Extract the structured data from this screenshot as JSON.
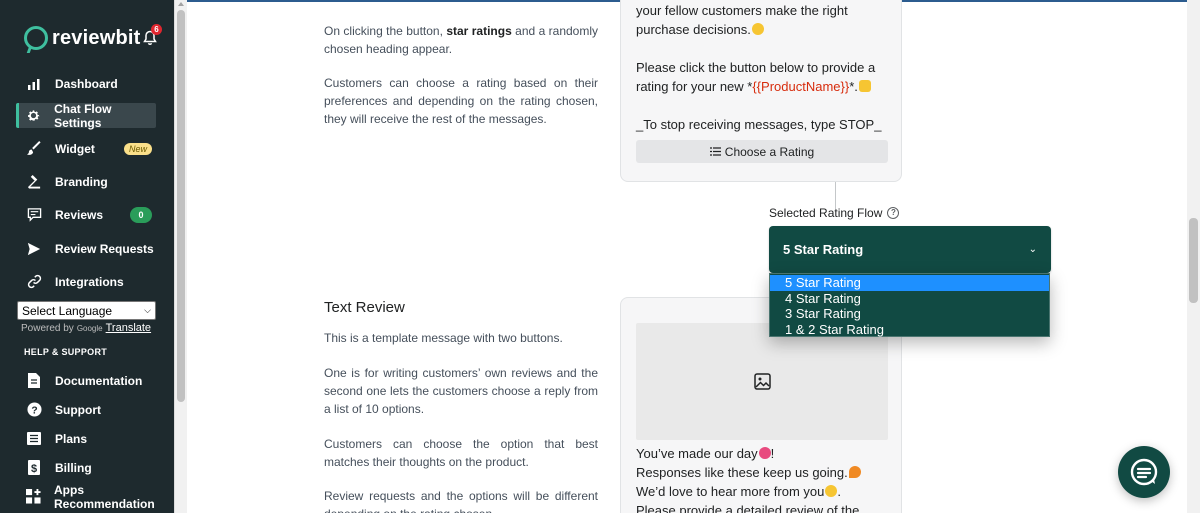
{
  "sidebar": {
    "brand": "reviewbit",
    "notification_count": "6",
    "items": [
      {
        "label": "Dashboard",
        "icon": "bar-chart-icon"
      },
      {
        "label": "Chat Flow Settings",
        "icon": "gear-icon",
        "active": true
      },
      {
        "label": "Widget",
        "icon": "brush-icon",
        "badge": "New"
      },
      {
        "label": "Branding",
        "icon": "hammer-icon"
      },
      {
        "label": "Reviews",
        "icon": "review-icon",
        "count": "0"
      },
      {
        "label": "Review Requests",
        "icon": "send-icon"
      },
      {
        "label": "Integrations",
        "icon": "link-icon"
      }
    ],
    "language_select": "Select Language",
    "powered_by": "Powered by",
    "google": "Google",
    "translate": "Translate",
    "help_title": "HELP & SUPPORT",
    "help_items": [
      {
        "label": "Documentation",
        "icon": "document-icon"
      },
      {
        "label": "Support",
        "icon": "question-icon"
      },
      {
        "label": "Plans",
        "icon": "list-icon"
      },
      {
        "label": "Billing",
        "icon": "dollar-icon"
      },
      {
        "label": "Apps Recommendation",
        "icon": "apps-icon"
      }
    ]
  },
  "rating_section": {
    "p1_before": "On clicking the button,",
    "p1_bold": "star ratings",
    "p1_after": "and a randomly chosen heading appear.",
    "p2": "Customers can choose a rating based on their preferences and depending on the rating chosen, they will receive the rest of the messages.",
    "msg_line1": "your fellow customers make the right",
    "msg_line2": "purchase decisions.",
    "msg_line3": "Please click the button below to provide a",
    "msg_line4_before": "rating for your new *",
    "msg_var": "{{ProductName}}",
    "msg_line4_after": "*.",
    "msg_line5": "_To stop receiving messages, type STOP_",
    "button": "Choose a Rating"
  },
  "flow_select": {
    "label": "Selected Rating Flow",
    "value": "5 Star Rating",
    "options": [
      "5 Star Rating",
      "4 Star Rating",
      "3 Star Rating",
      "1 & 2 Star Rating"
    ]
  },
  "text_review_section": {
    "title": "Text Review",
    "p1": "This is a template message with two buttons.",
    "p2": "One is for writing customers’ own reviews and the second one lets the customers choose a reply from a list of 10 options.",
    "p3": "Customers can choose the option that best matches their thoughts on the product.",
    "p4": "Review requests and the options will be different depending on the rating chosen.",
    "msg_line1": "You’ve made our day",
    "msg_line1_end": "!",
    "msg_line2": "Responses like these keep us going.",
    "msg_line3": "We’d love to hear more from you",
    "msg_line3_end": ".",
    "msg_line4": "Please provide a detailed review of the"
  },
  "colors": {
    "sidebar_bg": "#1e2a2e",
    "accent": "#3fbf9f",
    "select_bg": "#114a43",
    "option_highlight": "#1e90ff",
    "variable_red": "#d72c0d"
  }
}
